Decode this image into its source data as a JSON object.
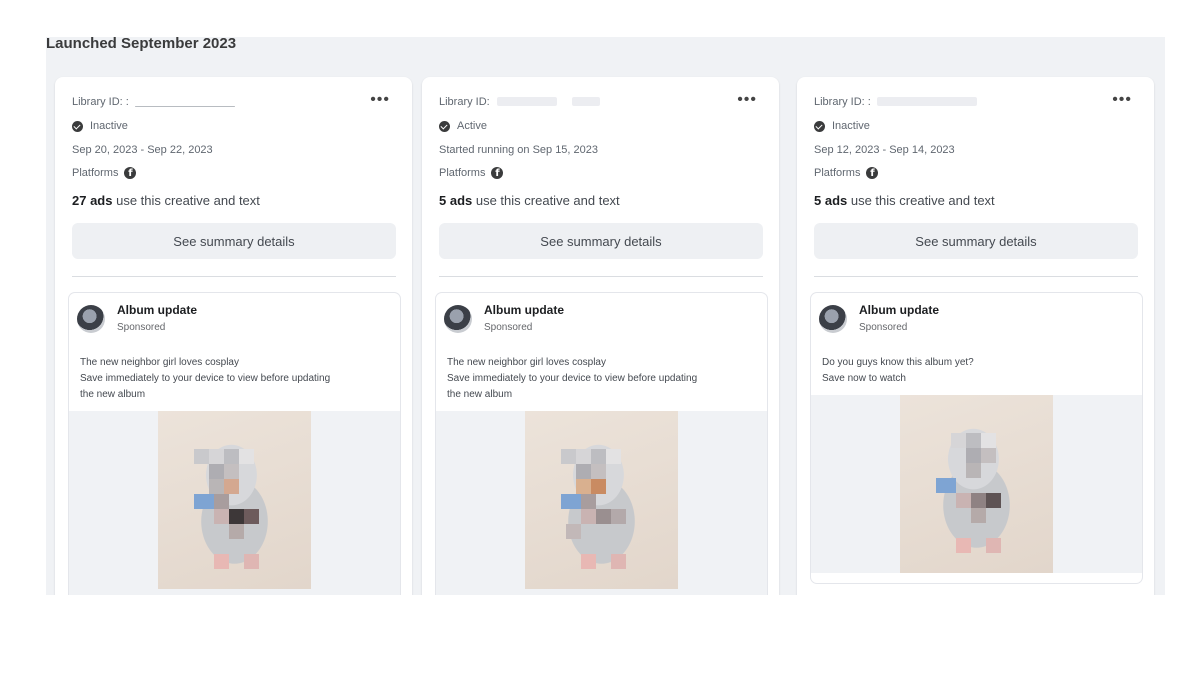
{
  "section_title": "Launched September 2023",
  "cards": [
    {
      "library_id_label": "Library ID: :",
      "status": "Inactive",
      "dates": "Sep 20, 2023 - Sep 22, 2023",
      "platforms_label": "Platforms",
      "ad_count": "27 ads",
      "ad_count_suffix": " use this creative and text",
      "summary_button": "See summary details",
      "post": {
        "title": "Album update",
        "subtitle": "Sponsored",
        "lines": [
          "The new neighbor girl loves cosplay",
          "Save immediately to your device to view before updating",
          "the new album"
        ]
      }
    },
    {
      "library_id_label": "Library ID:",
      "status": "Active",
      "dates": "Started running on Sep 15, 2023",
      "platforms_label": "Platforms",
      "ad_count": "5 ads",
      "ad_count_suffix": " use this creative and text",
      "summary_button": "See summary details",
      "post": {
        "title": "Album update",
        "subtitle": "Sponsored",
        "lines": [
          "The new neighbor girl loves cosplay",
          "Save immediately to your device to view before updating",
          "the new album"
        ]
      }
    },
    {
      "library_id_label": "Library ID: :",
      "status": "Inactive",
      "dates": "Sep 12, 2023 - Sep 14, 2023",
      "platforms_label": "Platforms",
      "ad_count": "5 ads",
      "ad_count_suffix": " use this creative and text",
      "summary_button": "See summary details",
      "post": {
        "title": "Album update",
        "subtitle": "Sponsored",
        "lines": [
          "Do you guys know this album yet?",
          "Save now to watch"
        ]
      }
    }
  ],
  "more_icon": "more-options-icon",
  "status_icon": "check-circle-icon",
  "platform_icon": "facebook-icon"
}
